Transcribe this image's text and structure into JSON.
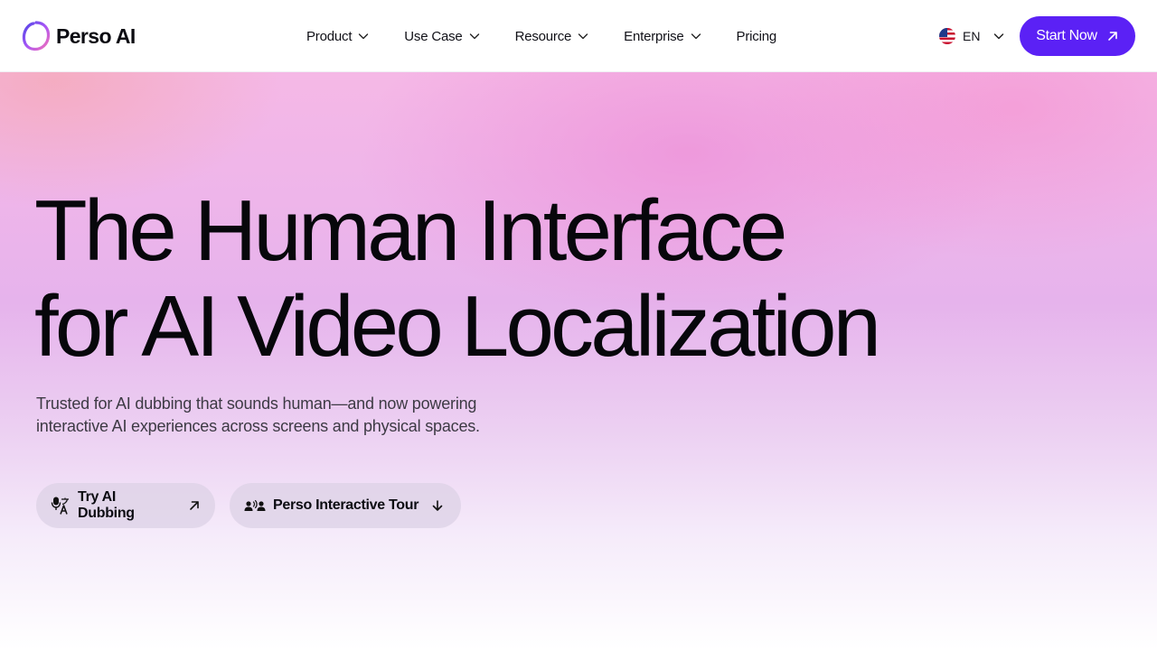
{
  "brand": {
    "name": "Perso AI",
    "accent": "#5b21f5"
  },
  "nav": {
    "items": [
      {
        "label": "Product",
        "has_menu": true
      },
      {
        "label": "Use Case",
        "has_menu": true
      },
      {
        "label": "Resource",
        "has_menu": true
      },
      {
        "label": "Enterprise",
        "has_menu": true
      },
      {
        "label": "Pricing",
        "has_menu": false
      }
    ]
  },
  "language": {
    "code": "EN",
    "flag": "us-flag-icon"
  },
  "header_cta": {
    "label": "Start Now",
    "icon": "arrow-up-right-icon"
  },
  "hero": {
    "headline_line1": "The Human Interface",
    "headline_line2": "for AI Video Localization",
    "subtitle_line1": "Trusted for AI dubbing that sounds human—and now powering",
    "subtitle_line2": "interactive AI experiences across screens and physical spaces.",
    "buttons": [
      {
        "label": "Try AI Dubbing",
        "icon": "mic-translate-icon",
        "trail_icon": "arrow-up-right-icon"
      },
      {
        "label": "Perso Interactive Tour",
        "icon": "people-speaking-icon",
        "trail_icon": "arrow-down-icon"
      }
    ]
  }
}
